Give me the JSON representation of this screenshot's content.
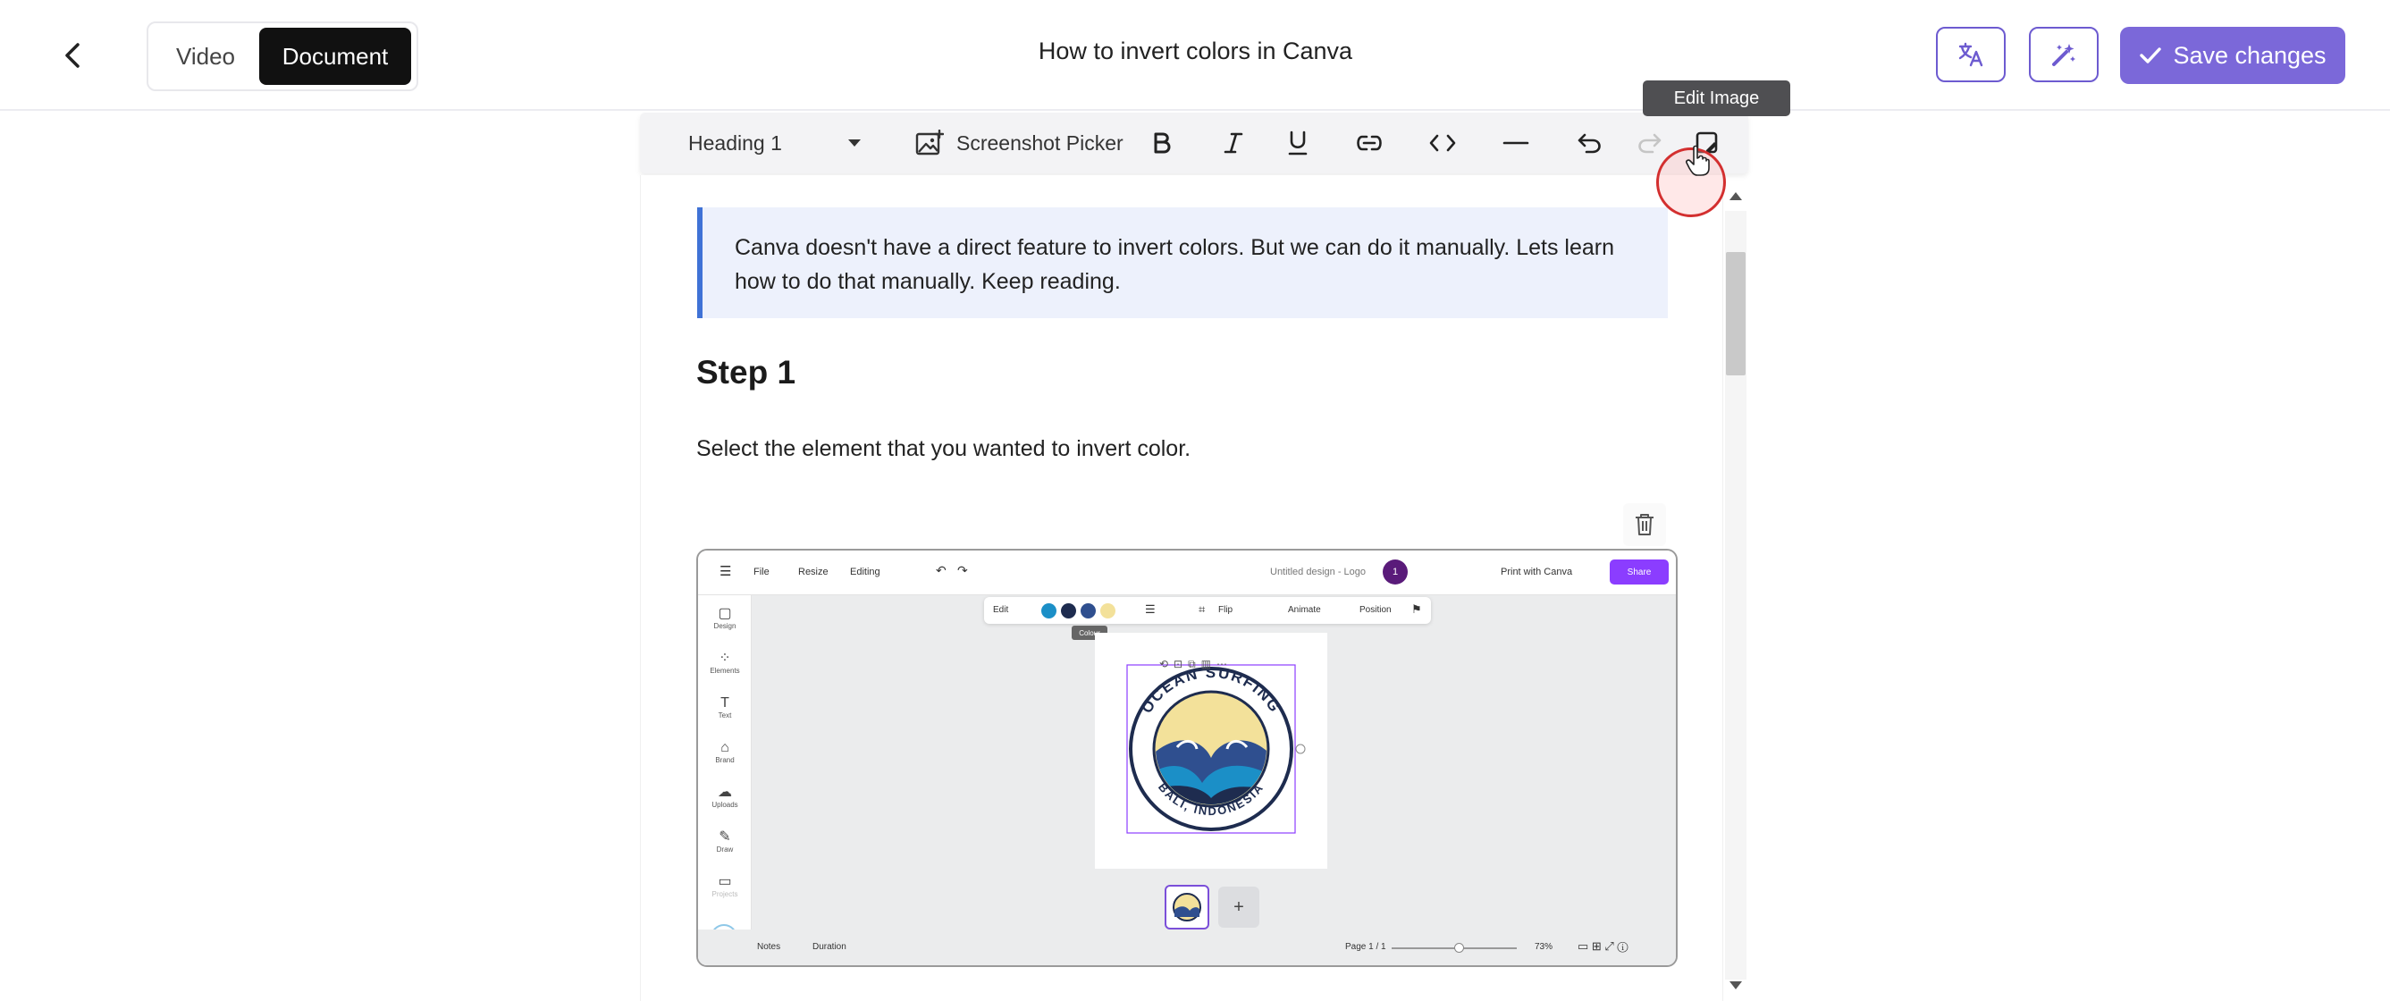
{
  "header": {
    "back_icon": "chevron-left-icon",
    "tabs": {
      "video": "Video",
      "document": "Document"
    },
    "title": "How to invert colors in Canva",
    "translate_icon": "translate-icon",
    "magic_icon": "magic-wand-icon",
    "save_label": "Save changes",
    "accent_color": "#7b68d9"
  },
  "toolbar": {
    "heading_select": "Heading 1",
    "screenshot_picker": "Screenshot Picker",
    "tooltip": "Edit Image"
  },
  "document": {
    "callout": "Canva doesn't have a direct feature to invert colors. But we can do it manually. Lets learn how to do that manually. Keep reading.",
    "step_heading": "Step 1",
    "step_text": "Select the element that you wanted to invert color."
  },
  "canva": {
    "menu": {
      "file": "File",
      "resize": "Resize",
      "editing": "Editing"
    },
    "doc_name": "Untitled design - Logo",
    "avatar": "1",
    "print": "Print with Canva",
    "share": "Share",
    "context": {
      "edit": "Edit",
      "flip": "Flip",
      "animate": "Animate",
      "position": "Position"
    },
    "swatches": [
      "#1b8fc7",
      "#1e2c4f",
      "#2f4f8f",
      "#f3e19a"
    ],
    "colour_tip": "Colour",
    "sidebar": [
      "Design",
      "Elements",
      "Text",
      "Brand",
      "Uploads",
      "Draw",
      "Projects"
    ],
    "logo_top": "OCEAN SURFING",
    "logo_bottom": "BALI, INDONESIA",
    "bottom": {
      "notes": "Notes",
      "duration": "Duration",
      "page": "Page 1 / 1",
      "zoom": "73%"
    }
  }
}
